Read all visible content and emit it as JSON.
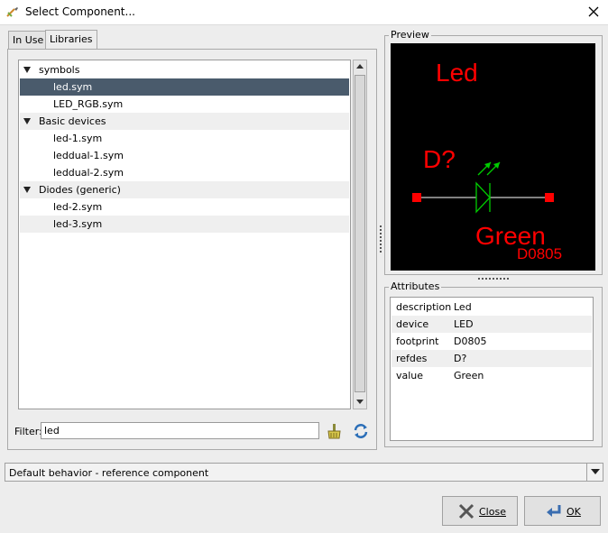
{
  "window": {
    "title": "Select Component..."
  },
  "tabs": [
    {
      "label": "In Use"
    },
    {
      "label": "Libraries"
    }
  ],
  "tree": {
    "rows": [
      {
        "label": "symbols",
        "level": 0,
        "expanded": true,
        "selected": false
      },
      {
        "label": "led.sym",
        "level": 1,
        "selected": true
      },
      {
        "label": "LED_RGB.sym",
        "level": 1,
        "selected": false
      },
      {
        "label": "Basic devices",
        "level": 0,
        "expanded": true,
        "selected": false
      },
      {
        "label": "led-1.sym",
        "level": 1,
        "selected": false
      },
      {
        "label": "leddual-1.sym",
        "level": 1,
        "selected": false
      },
      {
        "label": "leddual-2.sym",
        "level": 1,
        "selected": false
      },
      {
        "label": "Diodes (generic)",
        "level": 0,
        "expanded": true,
        "selected": false
      },
      {
        "label": "led-2.sym",
        "level": 1,
        "selected": false
      },
      {
        "label": "led-3.sym",
        "level": 1,
        "selected": false
      }
    ]
  },
  "filter": {
    "label": "Filter:",
    "value": "led"
  },
  "preview": {
    "title": "Preview",
    "texts": {
      "name": "Led",
      "refdes": "D?",
      "value": "Green",
      "footprint": "D0805"
    },
    "colors": {
      "background": "#000000",
      "text": "#ff0000",
      "pin": "#ffffff",
      "body": "#00cc00",
      "pin_end": "#ff0000"
    }
  },
  "attributes": {
    "title": "Attributes",
    "rows": [
      {
        "key": "description",
        "value": "Led"
      },
      {
        "key": "device",
        "value": "LED"
      },
      {
        "key": "footprint",
        "value": "D0805"
      },
      {
        "key": "refdes",
        "value": "D?"
      },
      {
        "key": "value",
        "value": "Green"
      }
    ]
  },
  "behavior": {
    "selected": "Default behavior - reference component"
  },
  "buttons": {
    "close": {
      "label": "Close",
      "icon": "close-x-icon"
    },
    "ok": {
      "label": "OK",
      "icon": "enter-arrow-icon"
    }
  },
  "colors": {
    "selection": "#4a5b6c",
    "window_bg": "#ededed"
  }
}
